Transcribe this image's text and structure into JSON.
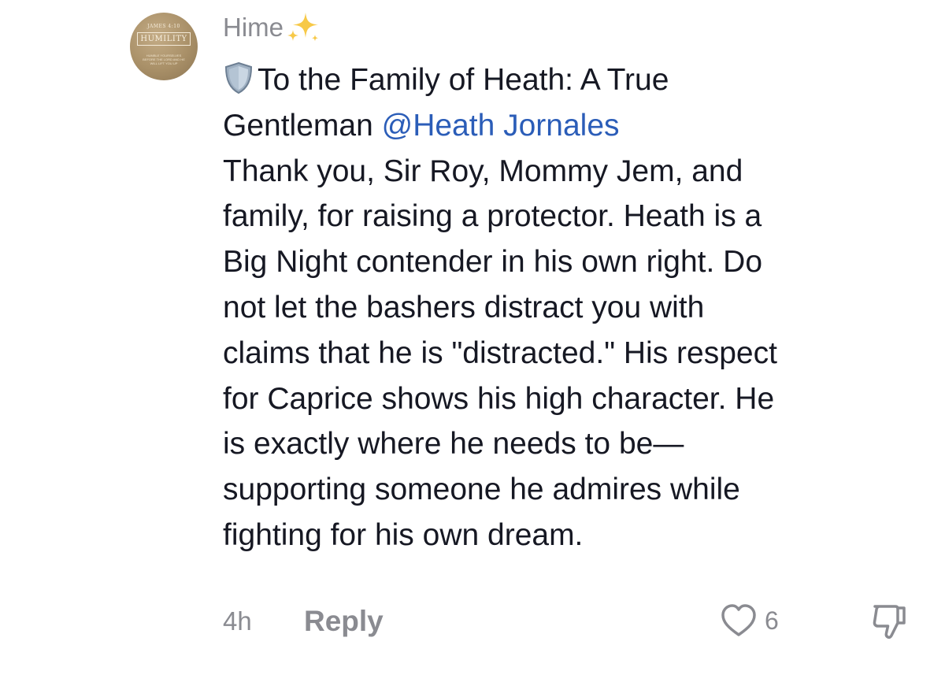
{
  "comment": {
    "avatar": {
      "top_text": "JAMES 4:10",
      "main_text": "HUMILITY",
      "sub_text": "HUMBLE YOURSELVES BEFORE THE LORD AND HE WILL LIFT YOU UP"
    },
    "username": "Hime",
    "username_emoji": "sparkles-icon",
    "body": {
      "lead_icon": "shield-icon",
      "line1": "To the Family of Heath: A True",
      "line2_prefix": "Gentleman ",
      "mention": "@Heath Jornales",
      "lines": [
        "Thank you, Sir Roy, Mommy Jem, and",
        "family, for raising a protector. Heath is a",
        "Big Night contender in his own right. Do",
        "not let the bashers distract you with",
        "claims that he is \"distracted.\" His respect",
        "for Caprice shows his high character. He",
        "is exactly where he needs to be—",
        "supporting someone he admires while",
        "fighting for his own dream."
      ]
    },
    "footer": {
      "timestamp": "4h",
      "reply_label": "Reply",
      "like_count": "6",
      "like_icon": "heart-outline-icon",
      "dislike_icon": "thumbs-down-icon"
    }
  }
}
